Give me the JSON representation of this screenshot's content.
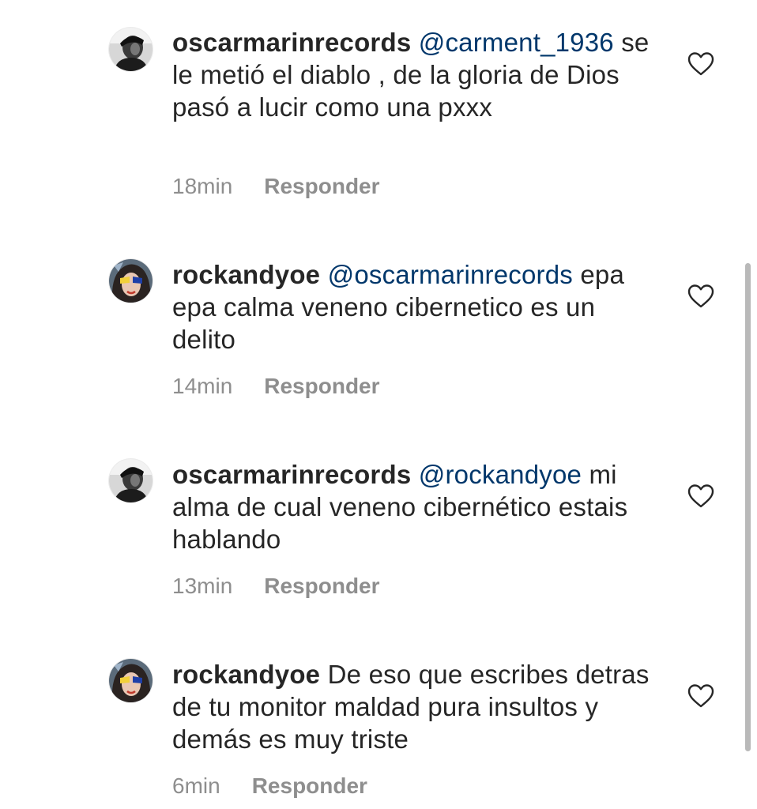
{
  "comments": [
    {
      "username": "oscarmarinrecords",
      "mention": "@carment_1936",
      "text": " se le metió el diablo , de la gloria de Dios pasó a lucir como una pxxx",
      "time": "18min",
      "reply_label": "Responder",
      "avatar": "male-avatar"
    },
    {
      "username": "rockandyoe",
      "mention": "@oscarmarinrecords",
      "text": " epa epa calma veneno cibernetico es un delito",
      "time": "14min",
      "reply_label": "Responder",
      "avatar": "female-avatar"
    },
    {
      "username": "oscarmarinrecords",
      "mention": "@rockandyoe",
      "text": " mi alma de cual veneno cibernético estais hablando",
      "time": "13min",
      "reply_label": "Responder",
      "avatar": "male-avatar"
    },
    {
      "username": "rockandyoe",
      "mention": "",
      "text": "De eso que escribes detras de tu monitor maldad pura insultos y demás es muy triste",
      "time": "6min",
      "reply_label": "Responder",
      "avatar": "female-avatar"
    }
  ],
  "icons": {
    "like": "heart-outline-icon"
  },
  "colors": {
    "text": "#262626",
    "mention": "#00376b",
    "meta": "#8e8e8e",
    "scrollbar": "#b9b9b9"
  }
}
